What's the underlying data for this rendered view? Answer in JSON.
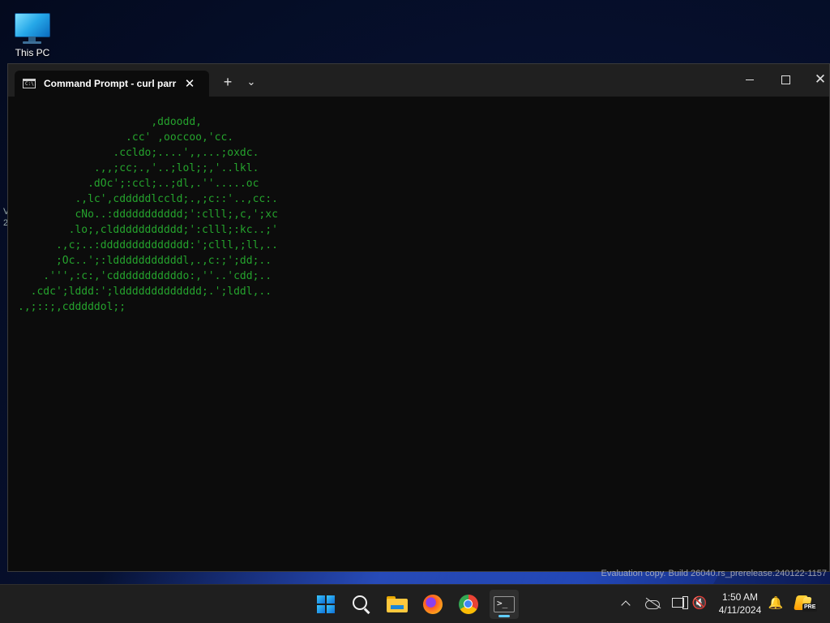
{
  "desktop": {
    "icons": [
      {
        "label": "This PC",
        "icon": "this-pc-icon"
      }
    ]
  },
  "window": {
    "tab_title": "Command Prompt - curl  parr",
    "tab_icon_text": "C:\\.",
    "close_tab_glyph": "✕",
    "new_tab_glyph": "+",
    "dropdown_glyph": "⌄",
    "close_window_glyph": "✕",
    "terminal_color": "#25a32d",
    "terminal_lines": [
      "                     ,ddoodd,",
      "                 .cc' ,ooccoo,'cc.",
      "               .ccldo;....',,...;oxdc.",
      "            .,,;cc;.,'..;lol;;,'..lkl.",
      "           .dOc';:ccl;..;dl,.''.....oc",
      "         .,lc',cdddddlccld;.,;c::'..,cc:.",
      "         cNo..:ddddddddddd;':clll;,c,';xc",
      "        .lo;,clddddddddddd;':clll;:kc..;'",
      "      .,c;..:dddddddddddddd:';clll,;ll,..",
      "      ;Oc..';:ldddddddddddl,.,c:;';dd;..",
      "    .''',:c:,'cdddddddddddo:,''..'cdd;..",
      "  .cdc';lddd:';lddddddddddddd;.';lddl,..",
      ".,;::;,cdddddol;;"
    ]
  },
  "left_peek": [
    "V",
    "2"
  ],
  "watermark": "Evaluation copy. Build 26040.rs_prerelease.240122-1157",
  "taskbar": {
    "apps": [
      "start-button",
      "search",
      "file-explorer",
      "firefox",
      "chrome",
      "terminal"
    ],
    "terminal_text": ">_",
    "clock_time": "1:50 AM",
    "clock_date": "4/11/2024",
    "volume_glyph": "🔇",
    "bell_glyph": "🔔",
    "copilot_badge": "PRE"
  }
}
